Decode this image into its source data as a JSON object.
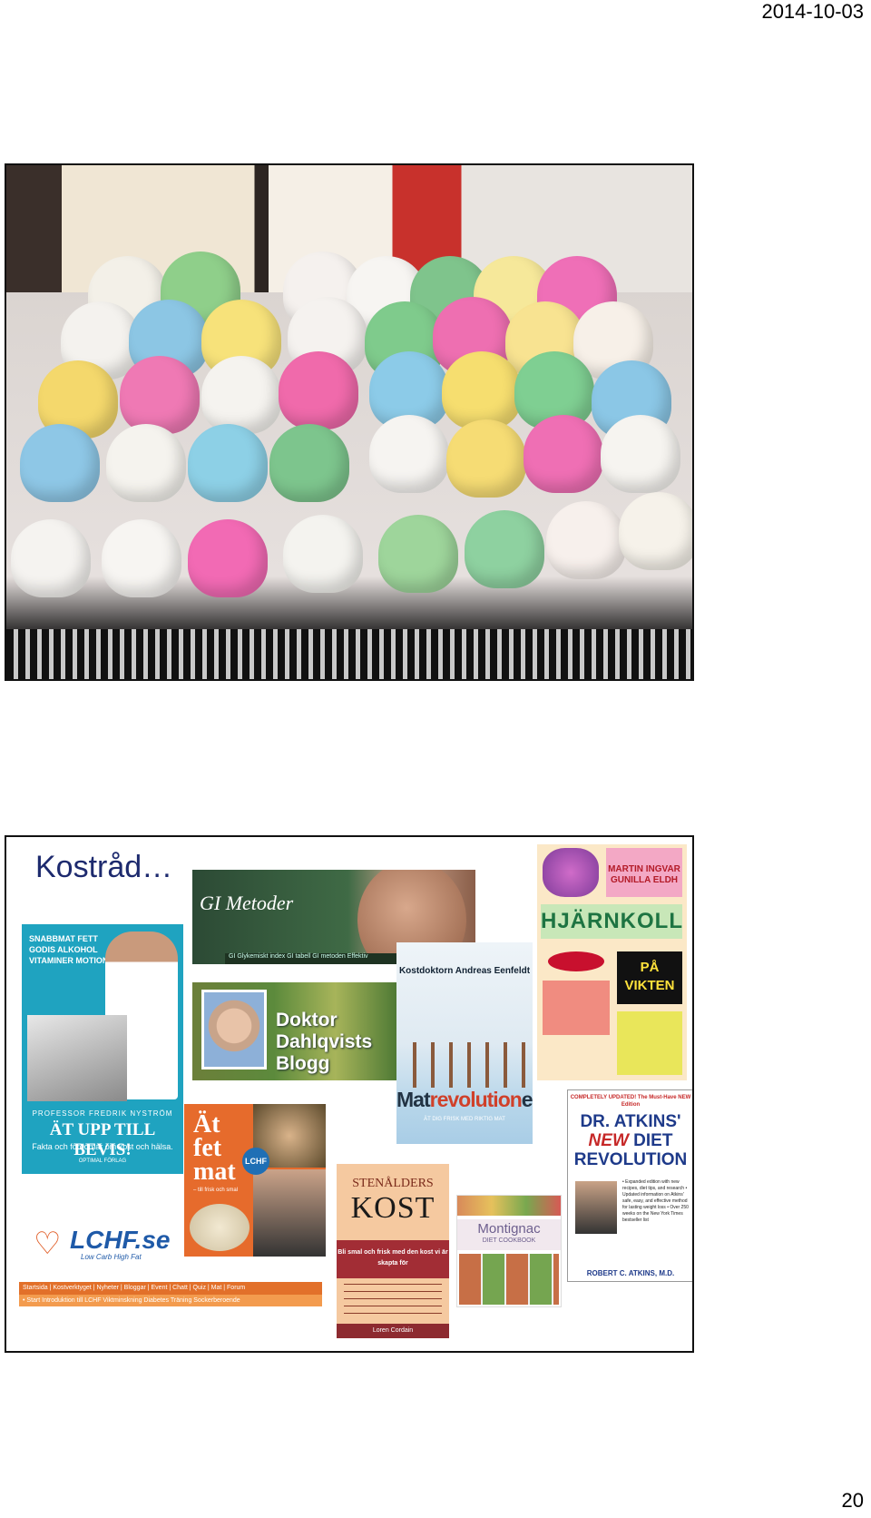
{
  "header": {
    "date": "2014-10-03"
  },
  "footer": {
    "page_number": "20"
  },
  "slide2": {
    "title": "Kostråd…",
    "gi": {
      "title": "GI Metoder",
      "nav": "GI  Glykemiskt index  GI tabell  GI metoden  Effektiv"
    },
    "atupp": {
      "top": "SNABBMAT FETT GODIS ALKOHOL VITAMINER MOTION",
      "author": "PROFESSOR FREDRIK NYSTRÖM",
      "title": "ÄT UPP TILL BEVIS!",
      "subtitle": "Fakta och fördomar om kost och hälsa.",
      "publisher": "OPTIMAL FÖRLAG"
    },
    "dahlqvist": {
      "line1": "Doktor",
      "line2": "Dahlqvists",
      "line3": "Blogg"
    },
    "matrev": {
      "author": "Kostdoktorn Andreas Eenfeldt",
      "title_a": "Mat",
      "title_b": "revolution",
      "title_c": "en",
      "subtitle": "ÄT DIG FRISK MED RIKTIG MAT"
    },
    "hjarnkoll": {
      "authors_1": "MARTIN INGVAR",
      "authors_2": "GUNILLA ELDH",
      "title": "HJÄRNKOLL",
      "pa": "PÅ",
      "vikten": "VIKTEN"
    },
    "atfet": {
      "title_1": "Ät",
      "title_2": "fet",
      "title_3": "mat",
      "badge": "LCHF",
      "sub": "– till frisk och smal"
    },
    "stenalders": {
      "title_1": "STENÅLDERS",
      "title_2": "KOST",
      "band": "Bli smal och frisk med den kost vi är skapta för",
      "author": "Loren Cordain"
    },
    "montignac": {
      "title": "Montignac",
      "subtitle": "DIET COOKBOOK"
    },
    "atkins": {
      "updated": "COMPLETELY UPDATED! The Must-Have NEW Edition",
      "t1": "DR. ATKINS'",
      "t2a": "NEW",
      "t2b": " DIET",
      "t3": "REVOLUTION",
      "blurb": "• Expanded edition with new recipes, diet tips, and research • Updated information on Atkins' safe, easy, and effective method for lasting weight loss • Over 250 weeks on the New York Times bestseller list",
      "author": "ROBERT C. ATKINS, M.D."
    },
    "lchf": {
      "name": "LCHF.se",
      "slogan": "Low Carb High Fat",
      "nav": "Startsida | Kostverktyget | Nyheter | Bloggar | Event | Chatt | Quiz | Mat | Forum",
      "subnav": "• Start   Introduktion till LCHF   Viktminskning   Diabetes   Träning   Sockerberoende"
    }
  },
  "colors": {
    "title_blue": "#1d2a6e",
    "accent_orange": "#e2702a"
  }
}
